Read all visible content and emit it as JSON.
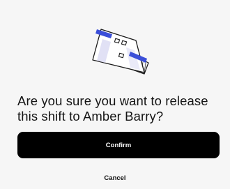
{
  "dialog": {
    "illustration_icon": "calendar-icon",
    "question": "Are you sure you want to release this shift to Amber Barry?",
    "confirm_label": "Confirm",
    "cancel_label": "Cancel"
  },
  "colors": {
    "background": "#f6f6f6",
    "primary_button": "#000000",
    "primary_button_text": "#ffffff",
    "text": "#141414",
    "accent": "#3b4fd8"
  }
}
